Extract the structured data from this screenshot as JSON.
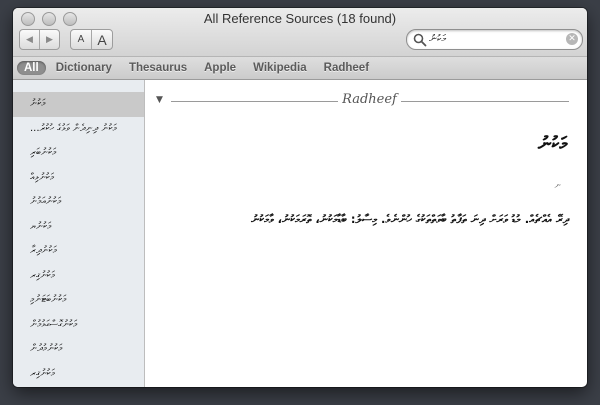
{
  "window": {
    "title": "All Reference Sources (18 found)"
  },
  "toolbar": {
    "back_icon": "◀",
    "forward_icon": "▶",
    "font_smaller_label": "A",
    "font_larger_label": "A"
  },
  "search": {
    "value": "މަކުނު",
    "placeholder": ""
  },
  "sources": [
    {
      "label": "All",
      "active": true
    },
    {
      "label": "Dictionary",
      "active": false
    },
    {
      "label": "Thesaurus",
      "active": false
    },
    {
      "label": "Apple",
      "active": false
    },
    {
      "label": "Wikipedia",
      "active": false
    },
    {
      "label": "Radheef",
      "active": false
    }
  ],
  "sidebar": {
    "items": [
      {
        "label": "މަކުނު",
        "selected": true
      },
      {
        "label": "މަކުނު ދިނިދެން ވަޅުގެ ހުކުރު...",
        "selected": false
      },
      {
        "label": "މަކުނުބަރި",
        "selected": false
      },
      {
        "label": "މަކުނުޅިއް",
        "selected": false
      },
      {
        "label": "މަކުނުއަމުނު",
        "selected": false
      },
      {
        "label": "މަކުނުޔ",
        "selected": false
      },
      {
        "label": "މަކުނުދިރާ",
        "selected": false
      },
      {
        "label": "މަކުނުޤިރ",
        "selected": false
      },
      {
        "label": "މަކުނުބަޓަނުމި",
        "selected": false
      },
      {
        "label": "މަކުނުގޮސްގަޅުމުން",
        "selected": false
      },
      {
        "label": "މަކުނުމުދުން",
        "selected": false
      },
      {
        "label": "މަކުނުޤިރ",
        "selected": false
      }
    ]
  },
  "entry": {
    "section_title": "Radheef",
    "disclosure_icon": "▼",
    "headword": "މަކުނު",
    "part_of_speech": "ނ",
    "definition": "ދިރޭ އެއްޗެއް. މުޑު ވަރަށް ދިނަ ތަފާތު ބާވަތްތަކުގެ ހުންނެވެ. މިސާލު: ބާޑާމަކުނު، ތޮރަމަކުނު، ވާމަކުނު"
  }
}
